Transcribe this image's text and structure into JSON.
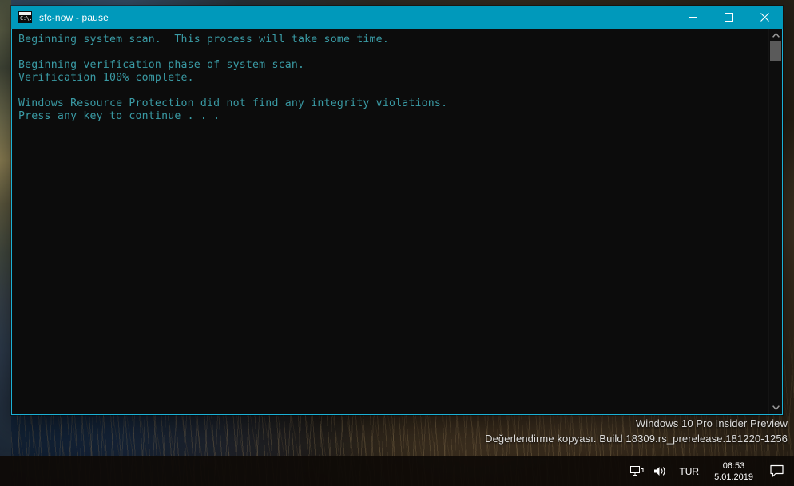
{
  "window": {
    "title": "sfc-now - pause",
    "icon_name": "command-prompt-icon",
    "icon_glyph": "C:\\.",
    "titlebar_color": "#0099bb",
    "border_color": "#1bb1d6",
    "background_color": "#0c0c0c",
    "text_color": "#3a9ba5",
    "controls": {
      "minimize_label": "─",
      "maximize_label": "☐",
      "close_label": "✕"
    }
  },
  "console": {
    "output": "Beginning system scan.  This process will take some time.\n\nBeginning verification phase of system scan.\nVerification 100% complete.\n\nWindows Resource Protection did not find any integrity violations.\nPress any key to continue . . .",
    "lines": [
      "Beginning system scan.  This process will take some time.",
      "",
      "Beginning verification phase of system scan.",
      "Verification 100% complete.",
      "",
      "Windows Resource Protection did not find any integrity violations.",
      "Press any key to continue . . ."
    ],
    "progress_percent": "100%",
    "scrollbar": {
      "up_arrow": "▲",
      "down_arrow": "▼"
    }
  },
  "watermark": {
    "line1": "Windows 10 Pro Insider Preview",
    "line2": "Değerlendirme kopyası. Build 18309.rs_prerelease.181220-1256"
  },
  "taskbar": {
    "tray": {
      "network_icon": "network-icon",
      "volume_icon": "volume-icon",
      "language": "TUR",
      "time": "06:53",
      "date": "5.01.2019",
      "action_center_icon": "action-center-icon"
    }
  }
}
